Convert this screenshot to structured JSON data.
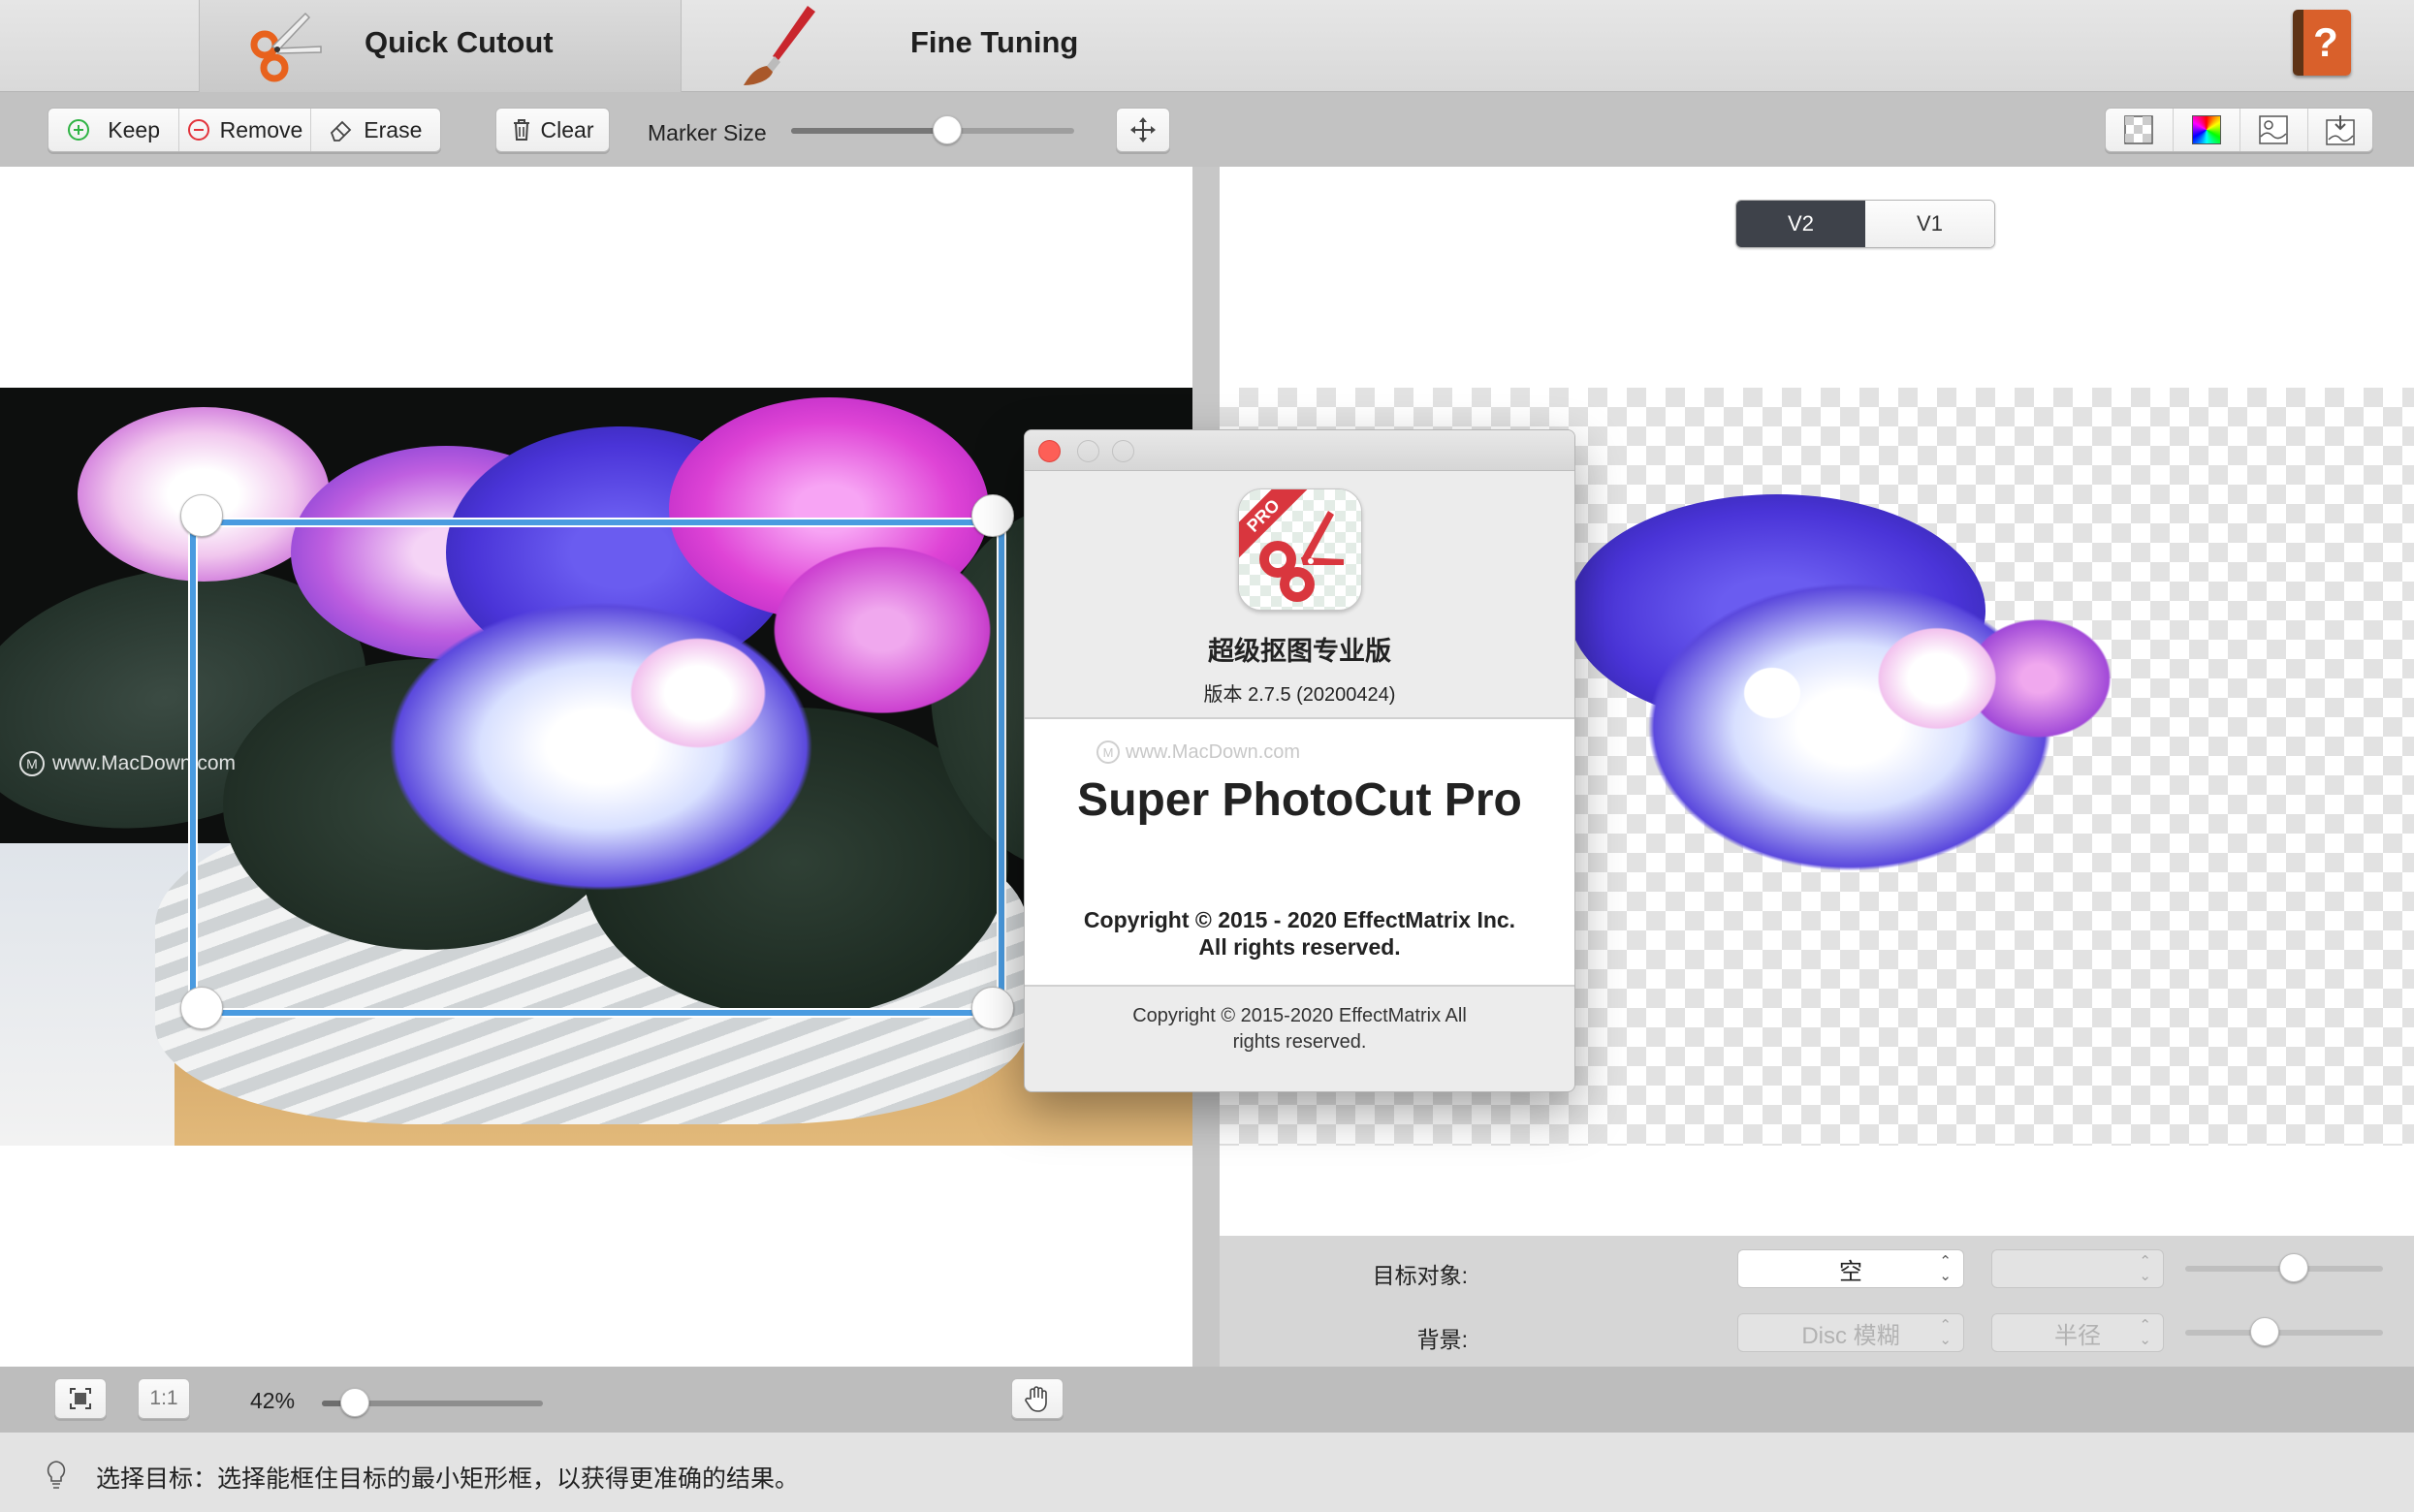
{
  "tabs": [
    {
      "label": "Quick Cutout",
      "icon": "scissors-icon",
      "active": true
    },
    {
      "label": "Fine Tuning",
      "icon": "paintbrush-icon",
      "active": false
    }
  ],
  "help_icon": "help-book-icon",
  "toolbar": {
    "keep_label": "Keep",
    "remove_label": "Remove",
    "erase_label": "Erase",
    "clear_label": "Clear",
    "marker_size_label": "Marker Size",
    "marker_size_value": 0.55,
    "move_icon": "move-arrows-icon",
    "view_buttons": [
      "transparent-bg-icon",
      "color-bg-icon",
      "image-bg-icon",
      "export-icon"
    ]
  },
  "version_toggle": {
    "options": [
      "V2",
      "V1"
    ],
    "selected": "V2"
  },
  "watermark": "www.MacDown.com",
  "about": {
    "app_name_cn": "超级抠图专业版",
    "version": "版本 2.7.5 (20200424)",
    "icon_badge": "PRO",
    "watermark": "www.MacDown.com",
    "product_name": "Super PhotoCut Pro",
    "copyright_line1": "Copyright © 2015 - 2020 EffectMatrix Inc.",
    "copyright_line2": "All rights reserved.",
    "footer_line1": "Copyright © 2015-2020 EffectMatrix  All",
    "footer_line2": "rights reserved."
  },
  "controls": {
    "target_label": "目标对象:",
    "target_value": "空",
    "target_value2": "",
    "target_slider": 0.55,
    "background_label": "背景:",
    "background_value": "Disc 模糊",
    "background_value2": "半径",
    "background_slider": 0.4
  },
  "zoom": {
    "fit_icon": "fit-screen-icon",
    "actual_label": "1:1",
    "percent": "42%",
    "slider": 0.15,
    "hand_icon": "hand-pan-icon"
  },
  "status": {
    "icon": "lightbulb-icon",
    "text": "选择目标：选择能框住目标的最小矩形框，以获得更准确的结果。"
  },
  "colors": {
    "selection": "#4a9be0",
    "close": "#fd5f57",
    "toggle_dark": "#3e424a",
    "icon_red": "#d9363e"
  }
}
